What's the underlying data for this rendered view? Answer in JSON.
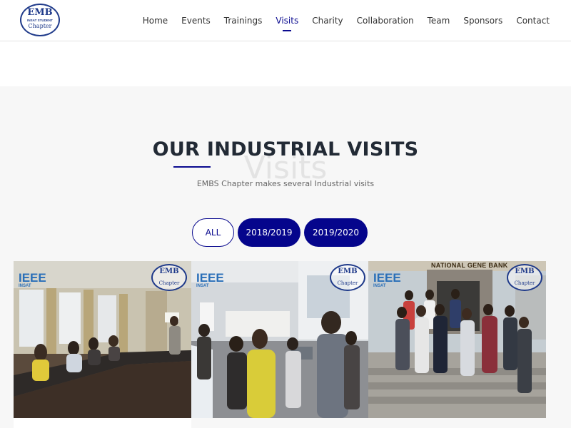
{
  "brand": {
    "logo_line1": "EMB",
    "logo_line2": "INSAT STUDENT",
    "logo_line3": "Chapter"
  },
  "nav": {
    "items": [
      "Home",
      "Events",
      "Trainings",
      "Visits",
      "Charity",
      "Collaboration",
      "Team",
      "Sponsors",
      "Contact"
    ],
    "active": "Visits"
  },
  "section": {
    "background_word": "Visits",
    "title": "OUR INDUSTRIAL VISITS",
    "subtitle": "EMBS Chapter makes several Industrial visits"
  },
  "filters": [
    {
      "label": "ALL",
      "style": "outline"
    },
    {
      "label": "2018/2019",
      "style": "filled"
    },
    {
      "label": "2019/2020",
      "style": "filled"
    }
  ],
  "gallery": [
    {
      "ieee": "IEEE",
      "ieee_sub": "INSAT",
      "wm_line1": "EMB",
      "wm_line2": "Chapter"
    },
    {
      "ieee": "IEEE",
      "ieee_sub": "INSAT",
      "wm_line1": "EMB",
      "wm_line2": "Chapter"
    },
    {
      "ieee": "IEEE",
      "ieee_sub": "INSAT",
      "wm_line1": "EMB",
      "wm_line2": "Chapter",
      "sign": "NATIONAL GENE BANK"
    }
  ],
  "colors": {
    "accent": "#05058c",
    "accent_outline": "#0a0a8f",
    "title": "#222a35",
    "subtitle": "#666666",
    "section_bg": "#f7f7f7"
  }
}
